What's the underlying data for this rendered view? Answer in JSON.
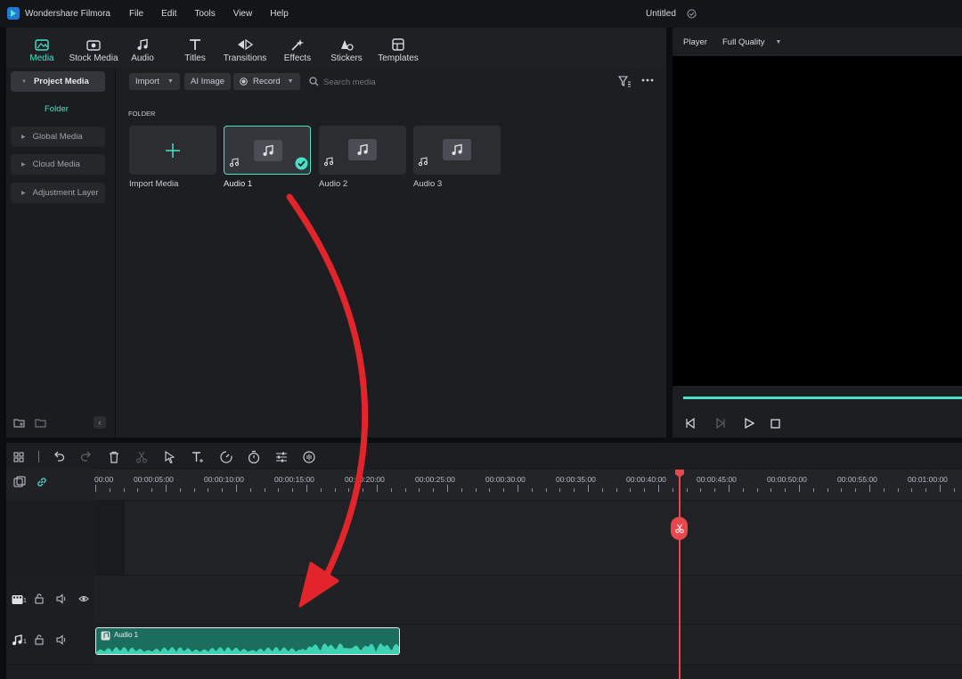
{
  "app": {
    "title": "Wondershare Filmora",
    "project_title": "Untitled"
  },
  "menu": [
    "File",
    "Edit",
    "Tools",
    "View",
    "Help"
  ],
  "tabs": [
    {
      "label": "Media",
      "icon": "media-icon",
      "active": true
    },
    {
      "label": "Stock Media",
      "icon": "stock-media-icon"
    },
    {
      "label": "Audio",
      "icon": "music-note-icon"
    },
    {
      "label": "Titles",
      "icon": "titles-icon"
    },
    {
      "label": "Transitions",
      "icon": "transitions-icon"
    },
    {
      "label": "Effects",
      "icon": "effects-icon"
    },
    {
      "label": "Stickers",
      "icon": "stickers-icon"
    },
    {
      "label": "Templates",
      "icon": "templates-icon"
    }
  ],
  "sidebar": {
    "project_media": "Project Media",
    "folder": "Folder",
    "items": [
      "Global Media",
      "Cloud Media",
      "Adjustment Layer"
    ]
  },
  "toolbar": {
    "import": "Import",
    "ai_image": "AI Image",
    "record": "Record",
    "search_placeholder": "Search media"
  },
  "content": {
    "section_label": "FOLDER",
    "import_label": "Import Media",
    "media": [
      {
        "label": "Audio 1",
        "selected": true
      },
      {
        "label": "Audio 2",
        "selected": false
      },
      {
        "label": "Audio 3",
        "selected": false
      }
    ]
  },
  "player": {
    "label": "Player",
    "quality": "Full Quality"
  },
  "timeline": {
    "ruler": [
      "00:00",
      "00:00:05:00",
      "00:00:10:00",
      "00:00:15:00",
      "00:00:20:00",
      "00:00:25:00",
      "00:00:30:00",
      "00:00:35:00",
      "00:00:40:00",
      "00:00:45:00",
      "00:00:50:00",
      "00:00:55:00",
      "00:01:00:00"
    ],
    "video_track_num": "1",
    "audio_track_num": "1",
    "clip_label": "Audio 1"
  },
  "colors": {
    "accent": "#49e0c5",
    "playhead": "#e8474d",
    "arrow": "#e1252b",
    "clip": "#1fa188"
  }
}
